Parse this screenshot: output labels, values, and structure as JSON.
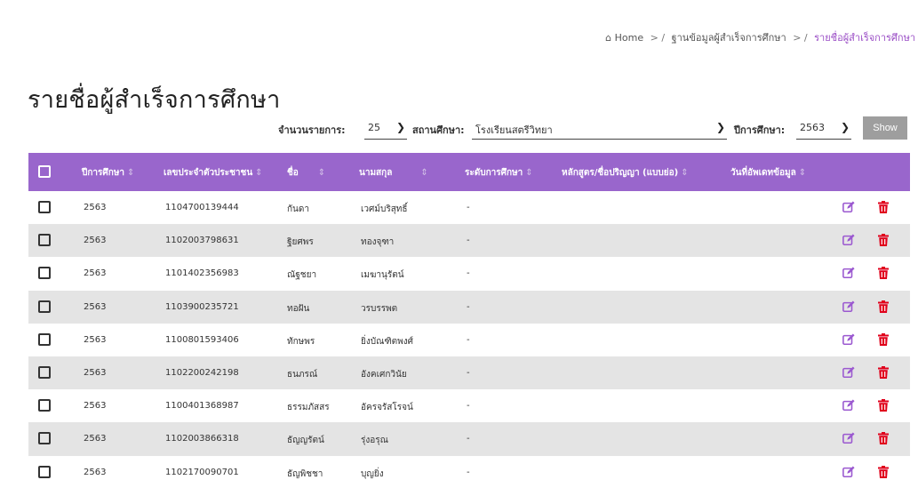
{
  "breadcrumb": {
    "home": "Home",
    "level2": "ฐานข้อมูลผู้สำเร็จการศึกษา",
    "current": "รายชื่อผู้สำเร็จการศึกษา"
  },
  "page_title": "รายชื่อผู้สำเร็จการศึกษา",
  "filters": {
    "entries_label": "จำนวนรายการ:",
    "entries_value": "25",
    "school_label": "สถานศึกษา:",
    "school_value": "โรงเรียนสตรีวิทยา",
    "year_label": "ปีการศึกษา:",
    "year_value": "2563",
    "show_label": "Show"
  },
  "table": {
    "headers": [
      "ปีการศึกษา",
      "เลขประจำตัวประชาชน",
      "ชื่อ",
      "นามสกุล",
      "ระดับการศึกษา",
      "หลักสูตร/ชื่อปริญญา (แบบย่อ)",
      "วันที่อัพเดทข้อมูล"
    ],
    "rows": [
      {
        "year": "2563",
        "id": "1104700139444",
        "first": "กันดา",
        "last": "เวศม์บริสุทธิ์",
        "level": "-"
      },
      {
        "year": "2563",
        "id": "1102003798631",
        "first": "ฐิยศพร",
        "last": "ทองจุฑา",
        "level": "-"
      },
      {
        "year": "2563",
        "id": "1101402356983",
        "first": "ณัฐชยา",
        "last": "เมฆานุรัตน์",
        "level": "-"
      },
      {
        "year": "2563",
        "id": "1103900235721",
        "first": "ทอฝัน",
        "last": "วรบรรพต",
        "level": "-"
      },
      {
        "year": "2563",
        "id": "1100801593406",
        "first": "ทักษพร",
        "last": "ยิ่งบัณฑิตพงศ์",
        "level": "-"
      },
      {
        "year": "2563",
        "id": "1102200242198",
        "first": "ธนภรณ์",
        "last": "อังคเศกวินัย",
        "level": "-"
      },
      {
        "year": "2563",
        "id": "1100401368987",
        "first": "ธรรมภัสสร",
        "last": "อัครจรัสโรจน์",
        "level": "-"
      },
      {
        "year": "2563",
        "id": "1102003866318",
        "first": "ธัญญรัตน์",
        "last": "รุ่งอรุณ",
        "level": "-"
      },
      {
        "year": "2563",
        "id": "1102170090701",
        "first": "ธัญพิชชา",
        "last": "บุญยิ่ง",
        "level": "-"
      }
    ]
  },
  "colors": {
    "header_bg": "#9966cc",
    "edit_icon": "#9b59d0",
    "delete_icon": "#e0001b",
    "show_button": "#9e9e9e"
  },
  "icons": {
    "home": "home-icon",
    "edit": "edit-icon",
    "delete": "trash-icon",
    "dropdown": "chevron-down-icon"
  }
}
